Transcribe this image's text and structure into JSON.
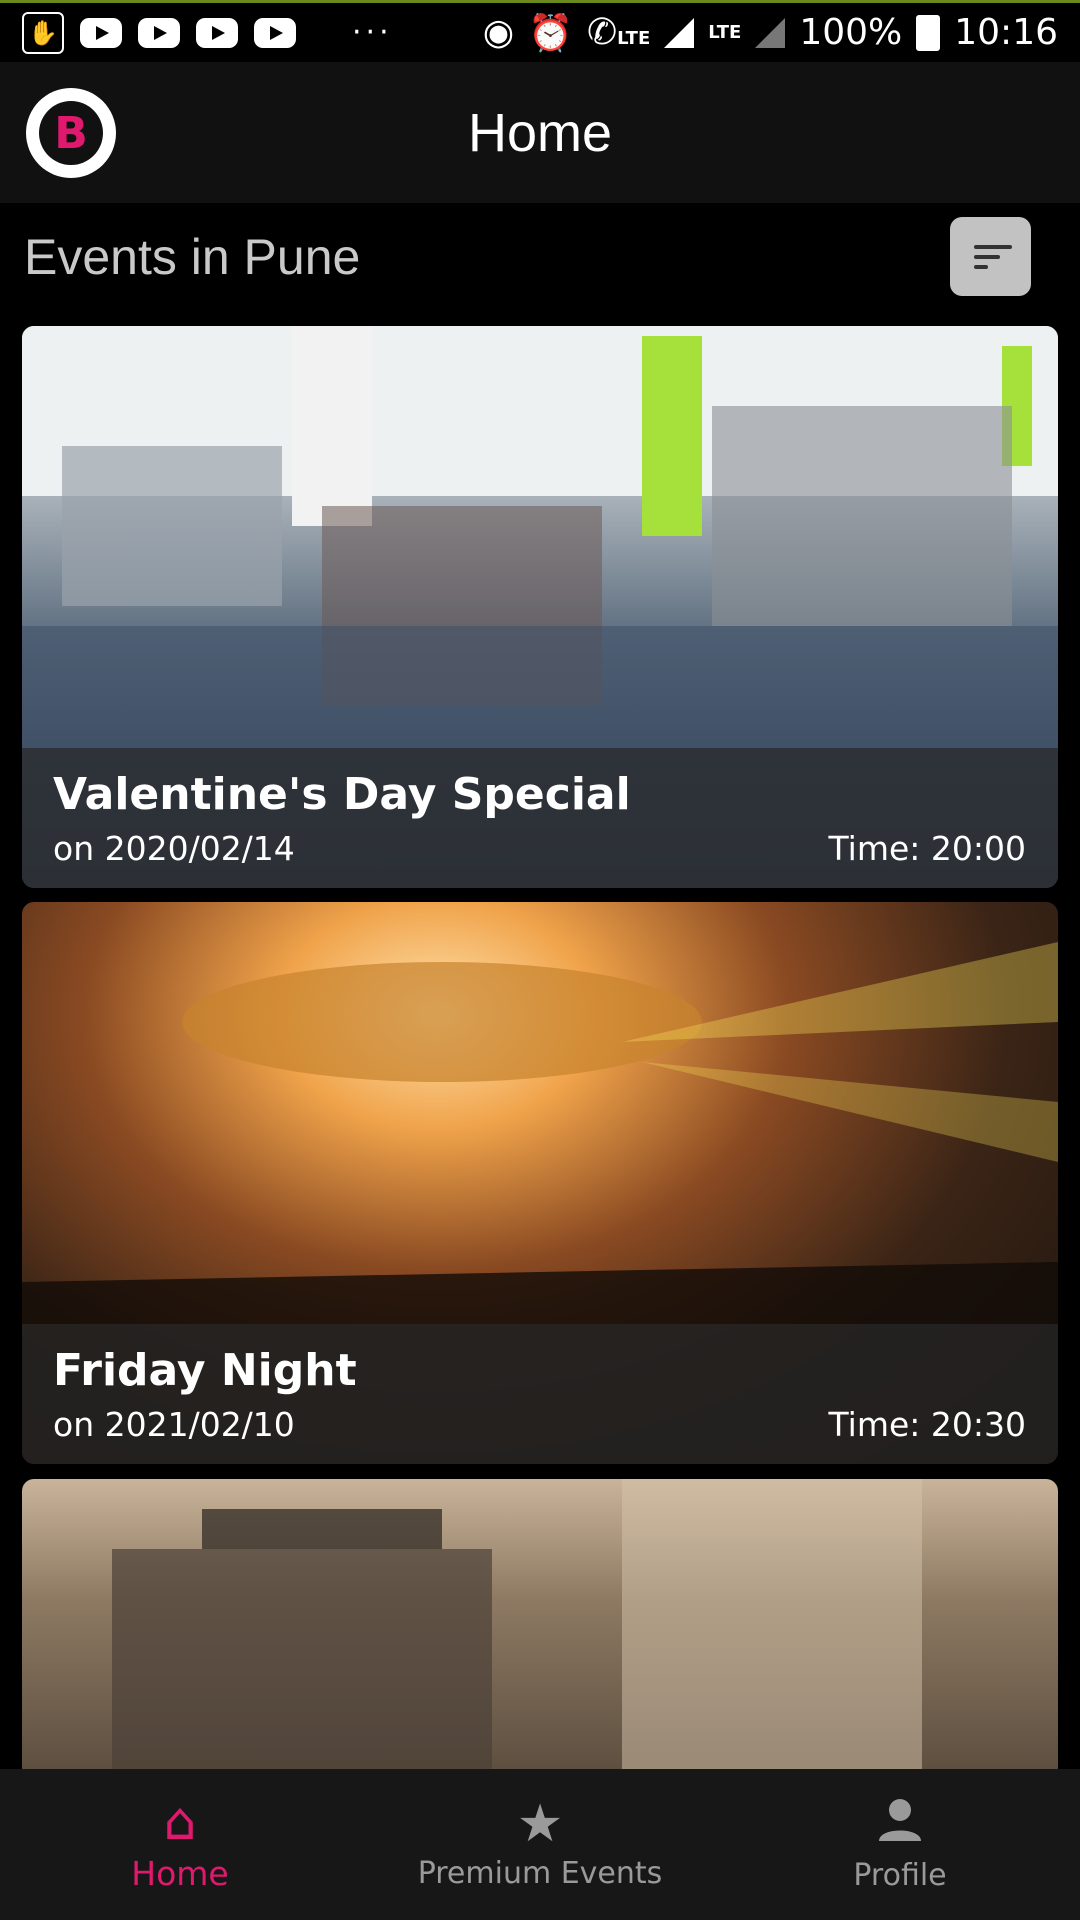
{
  "status_bar": {
    "battery": "100%",
    "time": "10:16",
    "lte_labels": [
      "LTE",
      "LTE"
    ]
  },
  "app_bar": {
    "title": "Home",
    "logo_letter": "B"
  },
  "section": {
    "title": "Events in Pune"
  },
  "events": [
    {
      "name": "Valentine's Day Special",
      "date": "on 2020/02/14",
      "time": "Time: 20:00"
    },
    {
      "name": "Friday Night",
      "date": "on 2021/02/10",
      "time": "Time: 20:30"
    }
  ],
  "bottom_nav": {
    "items": [
      {
        "label": "Home",
        "icon": "home-icon"
      },
      {
        "label": "Premium Events",
        "icon": "star-icon"
      },
      {
        "label": "Profile",
        "icon": "person-icon"
      }
    ],
    "active_color": "#e0196e"
  },
  "colors": {
    "accent": "#e0196e",
    "background": "#000000",
    "appbar": "#111111"
  }
}
